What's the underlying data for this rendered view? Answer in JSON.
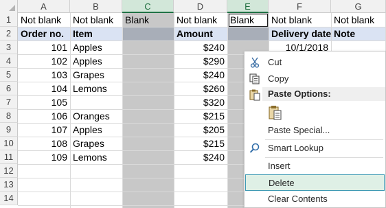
{
  "columns": {
    "A": "A",
    "B": "B",
    "C": "C",
    "D": "D",
    "E": "E",
    "F": "F",
    "G": "G"
  },
  "rows": [
    "1",
    "2",
    "3",
    "4",
    "5",
    "6",
    "7",
    "8",
    "9",
    "10",
    "11",
    "12",
    "13",
    "14"
  ],
  "row1": {
    "A": "Not blank",
    "B": "Not blank",
    "C": "Blank",
    "D": "Not blank",
    "E": "Blank",
    "F": "Not blank",
    "G": "Not blank"
  },
  "row2": {
    "A": "Order no.",
    "B": "Item",
    "D": "Amount",
    "F": "Delivery date",
    "G": "Note"
  },
  "data_rows": [
    {
      "order": "101",
      "item": "Apples",
      "amount": "$240",
      "date": "10/1/2018"
    },
    {
      "order": "102",
      "item": "Apples",
      "amount": "$290",
      "date": ""
    },
    {
      "order": "103",
      "item": "Grapes",
      "amount": "$240",
      "date": ""
    },
    {
      "order": "104",
      "item": "Lemons",
      "amount": "$260",
      "date": ""
    },
    {
      "order": "105",
      "item": "",
      "amount": "$320",
      "date": ""
    },
    {
      "order": "106",
      "item": "Oranges",
      "amount": "$215",
      "date": ""
    },
    {
      "order": "107",
      "item": "Apples",
      "amount": "$205",
      "date": ""
    },
    {
      "order": "108",
      "item": "Grapes",
      "amount": "$215",
      "date": ""
    },
    {
      "order": "109",
      "item": "Lemons",
      "amount": "$240",
      "date": ""
    }
  ],
  "context_menu": {
    "cut": "Cut",
    "copy": "Copy",
    "paste_options": "Paste Options:",
    "paste_special": "Paste Special...",
    "smart_lookup": "Smart Lookup",
    "insert": "Insert",
    "delete": "Delete",
    "clear_contents": "Clear Contents"
  },
  "colors": {
    "selected_column_fill": "#c8c8c8",
    "header_band": "#dae3f3",
    "selected_column_header": "#d2e7d9",
    "menu_highlight": "#dff0e6",
    "menu_highlight_border": "#3f9ab4"
  },
  "icons": {
    "cut": "scissors-icon",
    "copy": "copy-icon",
    "paste": "clipboard-icon",
    "smart_lookup": "search-icon"
  }
}
